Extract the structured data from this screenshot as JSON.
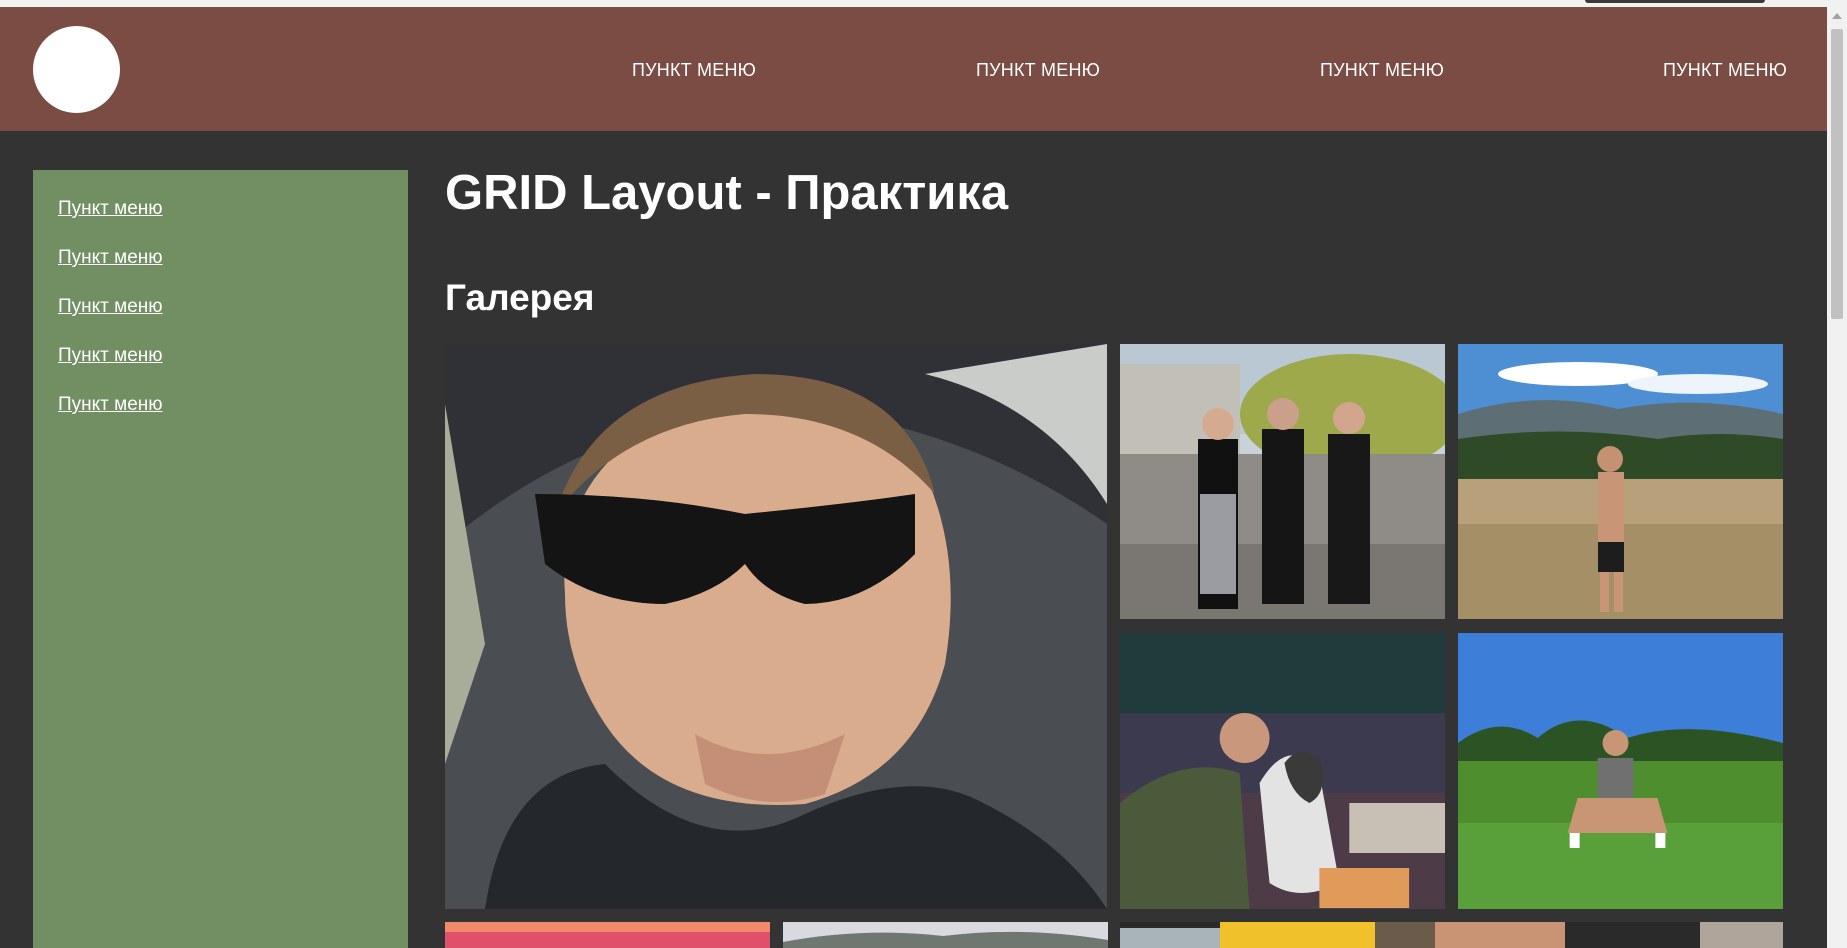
{
  "header": {
    "nav_items": [
      {
        "label": "ПУНКТ МЕНЮ"
      },
      {
        "label": "ПУНКТ МЕНЮ"
      },
      {
        "label": "ПУНКТ МЕНЮ"
      },
      {
        "label": "ПУНКТ МЕНЮ"
      }
    ]
  },
  "sidebar": {
    "items": [
      {
        "label": "Пункт меню"
      },
      {
        "label": "Пункт меню"
      },
      {
        "label": "Пункт меню"
      },
      {
        "label": "Пункт меню"
      },
      {
        "label": "Пункт меню"
      }
    ]
  },
  "main": {
    "title": "GRID Layout - Практика",
    "gallery_title": "Галерея"
  },
  "colors": {
    "header_bg": "#7b4c43",
    "sidebar_bg": "#718f63",
    "page_bg": "#333333"
  }
}
